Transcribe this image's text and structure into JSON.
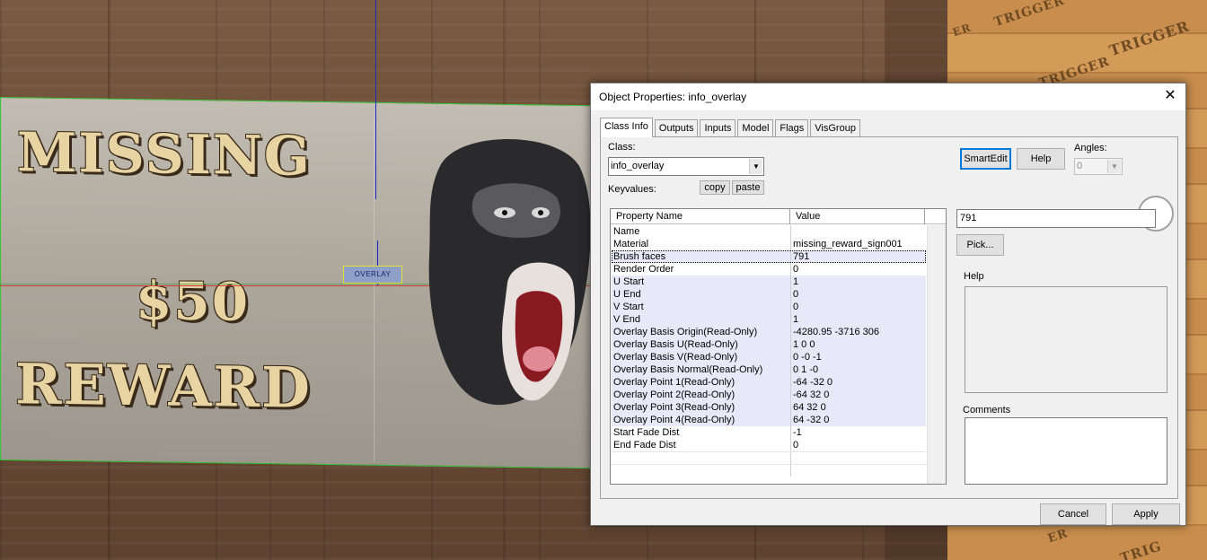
{
  "viewport": {
    "poster_line1": "MISSING",
    "poster_line2": "$50",
    "poster_line3": "REWARD",
    "overlay_tag": "OVERLAY",
    "trigger_words": [
      "TRIGGER",
      "TRIGGER",
      "TRIGGER",
      "ER",
      "ER",
      "TRIG"
    ]
  },
  "dialog": {
    "title": "Object Properties: info_overlay",
    "close_glyph": "✕",
    "tabs": [
      "Class Info",
      "Outputs",
      "Inputs",
      "Model",
      "Flags",
      "VisGroup"
    ],
    "class_label": "Class:",
    "class_value": "info_overlay",
    "keyvalues_label": "Keyvalues:",
    "copy_label": "copy",
    "paste_label": "paste",
    "smartedit_label": "SmartEdit",
    "help_button_label": "Help",
    "angles_label": "Angles:",
    "angles_value": "0",
    "grid": {
      "col_name": "Property Name",
      "col_value": "Value",
      "rows": [
        {
          "name": "Name",
          "value": ""
        },
        {
          "name": "Material",
          "value": "missing_reward_sign001"
        },
        {
          "name": "Brush faces",
          "value": "791"
        },
        {
          "name": "Render Order",
          "value": "0"
        },
        {
          "name": "U Start",
          "value": "1"
        },
        {
          "name": "U End",
          "value": "0"
        },
        {
          "name": "V Start",
          "value": "0"
        },
        {
          "name": "V End",
          "value": "1"
        },
        {
          "name": "Overlay Basis Origin(Read-Only)",
          "value": "-4280.95 -3716 306"
        },
        {
          "name": "Overlay Basis U(Read-Only)",
          "value": "1 0 0"
        },
        {
          "name": "Overlay Basis V(Read-Only)",
          "value": "0 -0 -1"
        },
        {
          "name": "Overlay Basis Normal(Read-Only)",
          "value": "0 1 -0"
        },
        {
          "name": "Overlay Point 1(Read-Only)",
          "value": "-64 -32 0"
        },
        {
          "name": "Overlay Point 2(Read-Only)",
          "value": "-64 32 0"
        },
        {
          "name": "Overlay Point 3(Read-Only)",
          "value": "64 32 0"
        },
        {
          "name": "Overlay Point 4(Read-Only)",
          "value": "64 -32 0"
        },
        {
          "name": "Start Fade Dist",
          "value": "-1"
        },
        {
          "name": "End Fade Dist",
          "value": "0"
        }
      ]
    },
    "value_edit": "791",
    "pick_label": "Pick...",
    "help_group_label": "Help",
    "comments_label": "Comments",
    "cancel_label": "Cancel",
    "apply_label": "Apply"
  }
}
